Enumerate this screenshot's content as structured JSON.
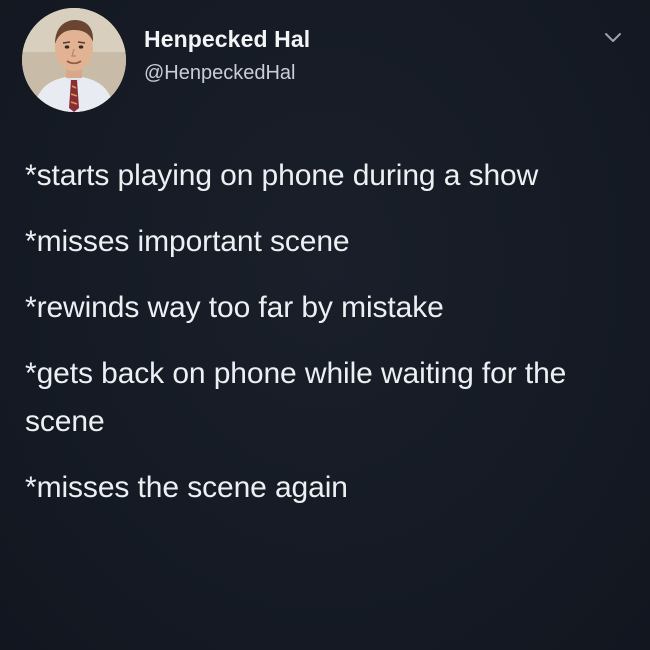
{
  "author": {
    "name": "Henpecked Hal",
    "handle": "@HenpeckedHal"
  },
  "icons": {
    "avatar": "user-avatar-photo",
    "menu": "chevron-down-icon"
  },
  "colors": {
    "background": "#151a24",
    "text": "#edf0f3",
    "handle": "#c9ced6"
  },
  "tweet_lines": [
    "*starts playing on phone during a show",
    "*misses important scene",
    "*rewinds way too far by mistake",
    "*gets back on phone while waiting for the scene",
    "*misses the scene again"
  ]
}
